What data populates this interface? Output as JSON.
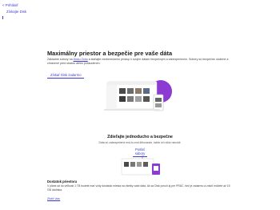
{
  "nav": {
    "back_label": "< Prihlásiť",
    "product_label": "Získajte Disk"
  },
  "hero": {
    "title": "Maximálny priestor a bezpečie pre vaše dáta",
    "desc_before": "Základné súbory na ",
    "desc_link": "Disku Zoho",
    "desc_after": " a staňajte neobmedzenú prístup k svojím dátam bezpečným a zabezpečením. Súbory sú bezpečne uložené a chránené pred stratou alebo poškodením.",
    "cta_label": "Získať Disk zadarmo"
  },
  "share": {
    "title": "Zdieľajte jednoducho a bezpečne",
    "subtitle": "Dáta sú zabezpečené end-to-end šifrovaním, takže ich nikto neuvidí.",
    "button_line1": "Poslať",
    "button_line2": "súbory"
  },
  "storage": {
    "title": "Dostatok priestoru",
    "desc": "V pláne až do veľkosti 1 TB budete mať vždy dostatok miesta na všetky vaše dáta. Ak sa Disk povolí aj pre PRÁC, tiež je zadarmo a získiť môžete až 15 GB úložiska.",
    "link_label": "Zistiť viac"
  },
  "colors": {
    "accent": "#3d3dd6",
    "brand_purple": "#8b3bd1",
    "panel_blue": "#cfd9ef",
    "text_dark": "#1a1a1a"
  }
}
